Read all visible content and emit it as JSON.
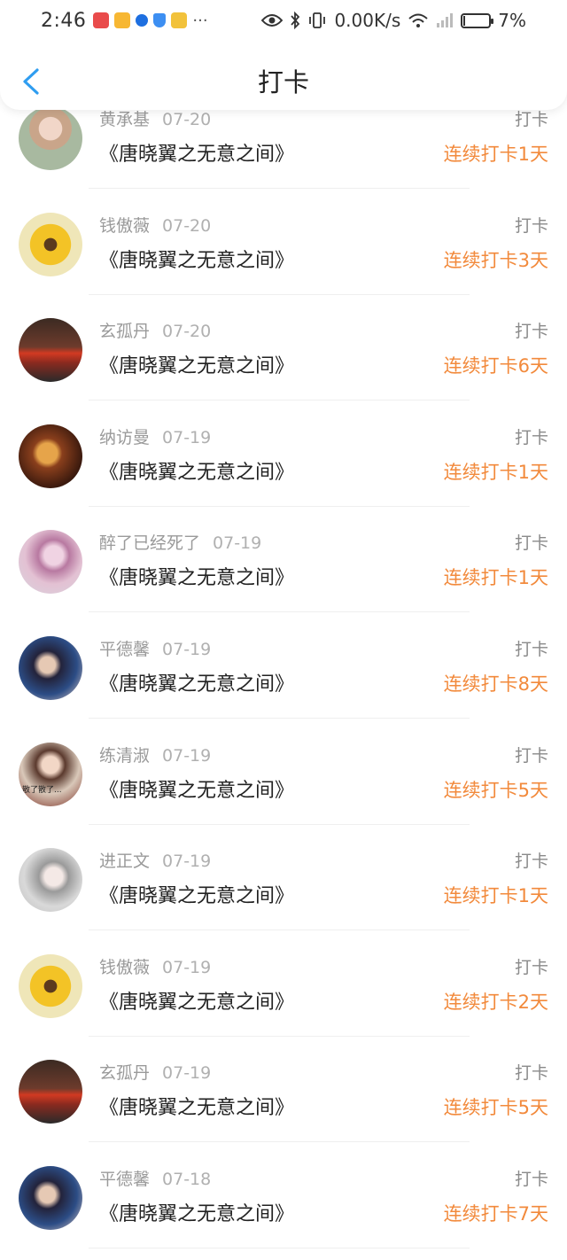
{
  "status_bar": {
    "time": "2:46",
    "network_speed": "0.00K/s",
    "battery_percent": "7%",
    "battery_level": 0.07
  },
  "header": {
    "title": "打卡"
  },
  "entries": [
    {
      "user": "黄承基",
      "date": "07-20",
      "book": "《唐晓翼之无意之间》",
      "action": "打卡",
      "streak": "连续打卡1天"
    },
    {
      "user": "钱傲薇",
      "date": "07-20",
      "book": "《唐晓翼之无意之间》",
      "action": "打卡",
      "streak": "连续打卡3天"
    },
    {
      "user": "玄孤丹",
      "date": "07-20",
      "book": "《唐晓翼之无意之间》",
      "action": "打卡",
      "streak": "连续打卡6天"
    },
    {
      "user": "纳访曼",
      "date": "07-19",
      "book": "《唐晓翼之无意之间》",
      "action": "打卡",
      "streak": "连续打卡1天"
    },
    {
      "user": "醉了已经死了",
      "date": "07-19",
      "book": "《唐晓翼之无意之间》",
      "action": "打卡",
      "streak": "连续打卡1天"
    },
    {
      "user": "平德馨",
      "date": "07-19",
      "book": "《唐晓翼之无意之间》",
      "action": "打卡",
      "streak": "连续打卡8天"
    },
    {
      "user": "练清淑",
      "date": "07-19",
      "book": "《唐晓翼之无意之间》",
      "action": "打卡",
      "streak": "连续打卡5天"
    },
    {
      "user": "进正文",
      "date": "07-19",
      "book": "《唐晓翼之无意之间》",
      "action": "打卡",
      "streak": "连续打卡1天"
    },
    {
      "user": "钱傲薇",
      "date": "07-19",
      "book": "《唐晓翼之无意之间》",
      "action": "打卡",
      "streak": "连续打卡2天"
    },
    {
      "user": "玄孤丹",
      "date": "07-19",
      "book": "《唐晓翼之无意之间》",
      "action": "打卡",
      "streak": "连续打卡5天"
    },
    {
      "user": "平德馨",
      "date": "07-18",
      "book": "《唐晓翼之无意之间》",
      "action": "打卡",
      "streak": "连续打卡7天"
    }
  ],
  "avatar_text": "散了散了..."
}
